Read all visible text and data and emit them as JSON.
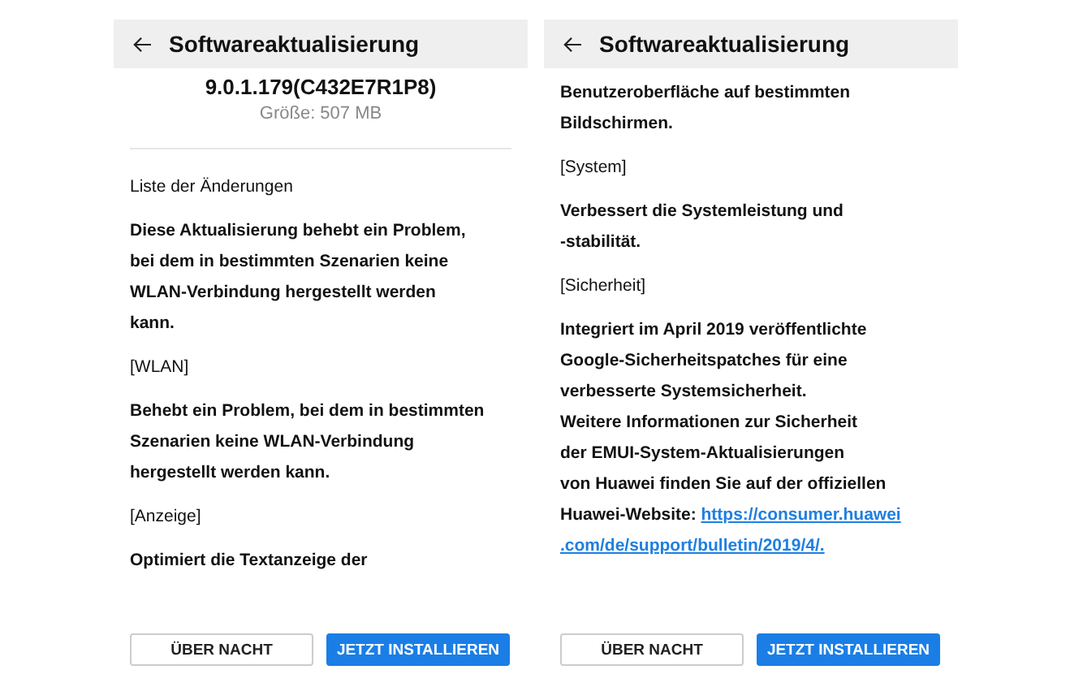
{
  "screens": [
    {
      "title": "Softwareaktualisierung",
      "version": "9.0.1.179(C432E7R1P8)",
      "size": "Größe: 507 MB",
      "blocks": [
        {
          "kind": "heading",
          "text": "Liste der Änderungen"
        },
        {
          "kind": "paragraph",
          "text": "Diese Aktualisierung behebt ein Problem,\nbei dem in bestimmten Szenarien keine\nWLAN-Verbindung hergestellt werden\nkann."
        },
        {
          "kind": "heading",
          "text": "[WLAN]"
        },
        {
          "kind": "paragraph",
          "text": "Behebt ein Problem, bei dem in bestimmten\nSzenarien keine WLAN-Verbindung\nhergestellt werden kann."
        },
        {
          "kind": "heading",
          "text": "[Anzeige]"
        },
        {
          "kind": "paragraph",
          "text": "Optimiert die Textanzeige der"
        }
      ],
      "buttons": [
        {
          "label": "ÜBER NACHT",
          "kind": "secondary"
        },
        {
          "label": "JETZT INSTALLIEREN",
          "kind": "primary"
        }
      ]
    },
    {
      "title": "Softwareaktualisierung",
      "blocks": [
        {
          "kind": "paragraph",
          "text": "Benutzeroberfläche auf bestimmten\nBildschirmen."
        },
        {
          "kind": "heading",
          "text": "[System]"
        },
        {
          "kind": "paragraph",
          "text": "Verbessert die Systemleistung und\n-stabilität."
        },
        {
          "kind": "heading",
          "text": "[Sicherheit]"
        },
        {
          "kind": "paragraph",
          "text": "Integriert im April 2019 veröffentlichte\nGoogle-Sicherheitspatches für eine\nverbesserte Systemsicherheit.\nWeitere Informationen zur Sicherheit\nder EMUI-System-Aktualisierungen\nvon Huawei finden Sie auf der offiziellen\nHuawei-Website: ",
          "link_lines": [
            "https://consumer.huawei",
            ".com/de/support/bulletin/2019/4/."
          ]
        }
      ],
      "buttons": [
        {
          "label": "ÜBER NACHT",
          "kind": "secondary"
        },
        {
          "label": "JETZT INSTALLIEREN",
          "kind": "primary"
        }
      ]
    }
  ]
}
